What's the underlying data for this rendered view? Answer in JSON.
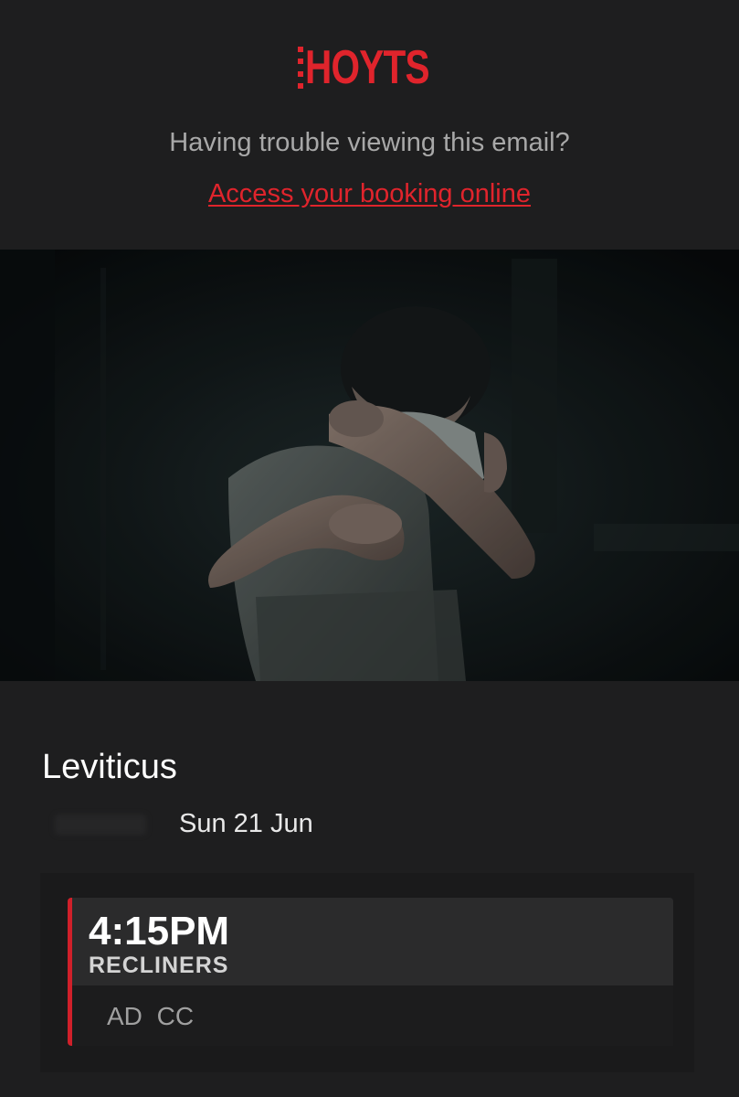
{
  "brand": {
    "logo_text": "HOYTS",
    "accent_color": "#e0242c"
  },
  "header": {
    "trouble_text": "Having trouble viewing this email?",
    "access_link": "Access your booking online"
  },
  "hero": {
    "image_name": "movie-still"
  },
  "booking": {
    "movie_title": "Leviticus",
    "date": "Sun 21 Jun",
    "session": {
      "time": "4:15PM",
      "type": "RECLINERS",
      "tags": "AD  CC"
    }
  }
}
